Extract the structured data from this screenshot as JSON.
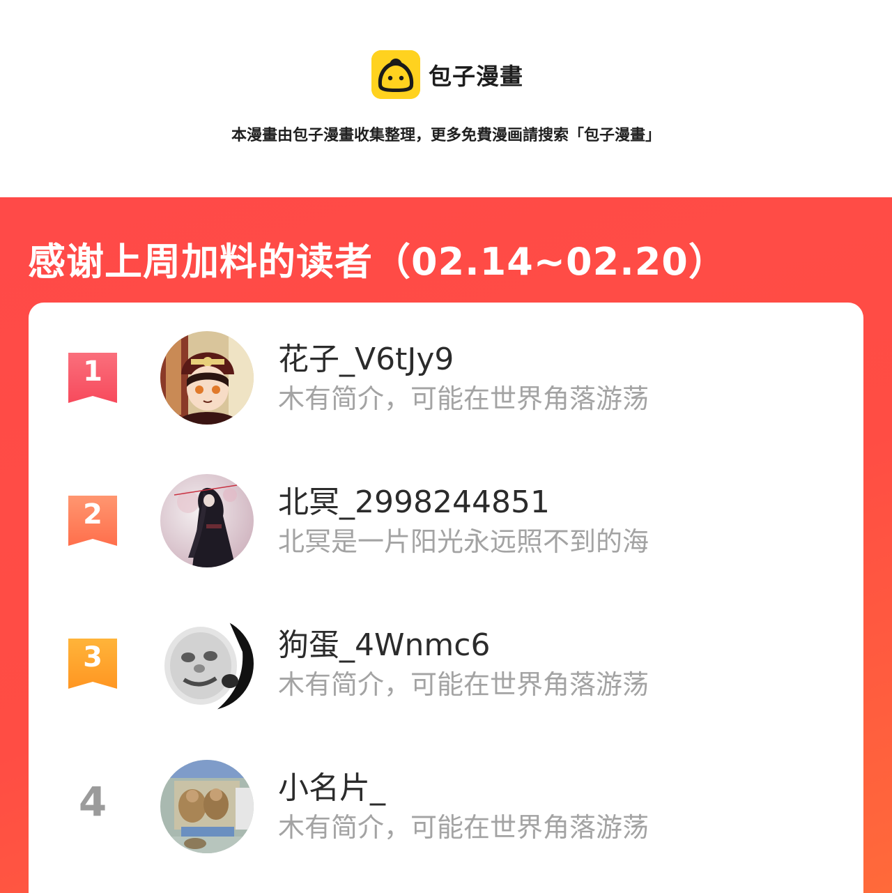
{
  "brand": {
    "name": "包子漫畫",
    "color": "#ffd21f"
  },
  "notice": "本漫畫由包子漫畫收集整理，更多免費漫画請搜索「包子漫畫」",
  "panel": {
    "title": "感谢上周加料的读者（02.14~02.20）",
    "background": "#ff4a48"
  },
  "readers": [
    {
      "rank": "1",
      "name": "花子_V6tJy9",
      "bio": "木有简介，可能在世界角落游荡",
      "badge_color": "#fb5a67",
      "avatar_icon": "anime-boy-avatar"
    },
    {
      "rank": "2",
      "name": "北冥_2998244851",
      "bio": "北冥是一片阳光永远照不到的海",
      "badge_color": "#ff7b55",
      "avatar_icon": "dark-figure-avatar"
    },
    {
      "rank": "3",
      "name": "狗蛋_4Wnmc6",
      "bio": "木有简介，可能在世界角落游荡",
      "badge_color": "#ffa22a",
      "avatar_icon": "meme-face-avatar"
    },
    {
      "rank": "4",
      "name": "小名片_",
      "bio": "木有简介，可能在世界角落游荡",
      "badge_color": "#9b9b9b",
      "avatar_icon": "monkeys-photo-avatar"
    }
  ]
}
